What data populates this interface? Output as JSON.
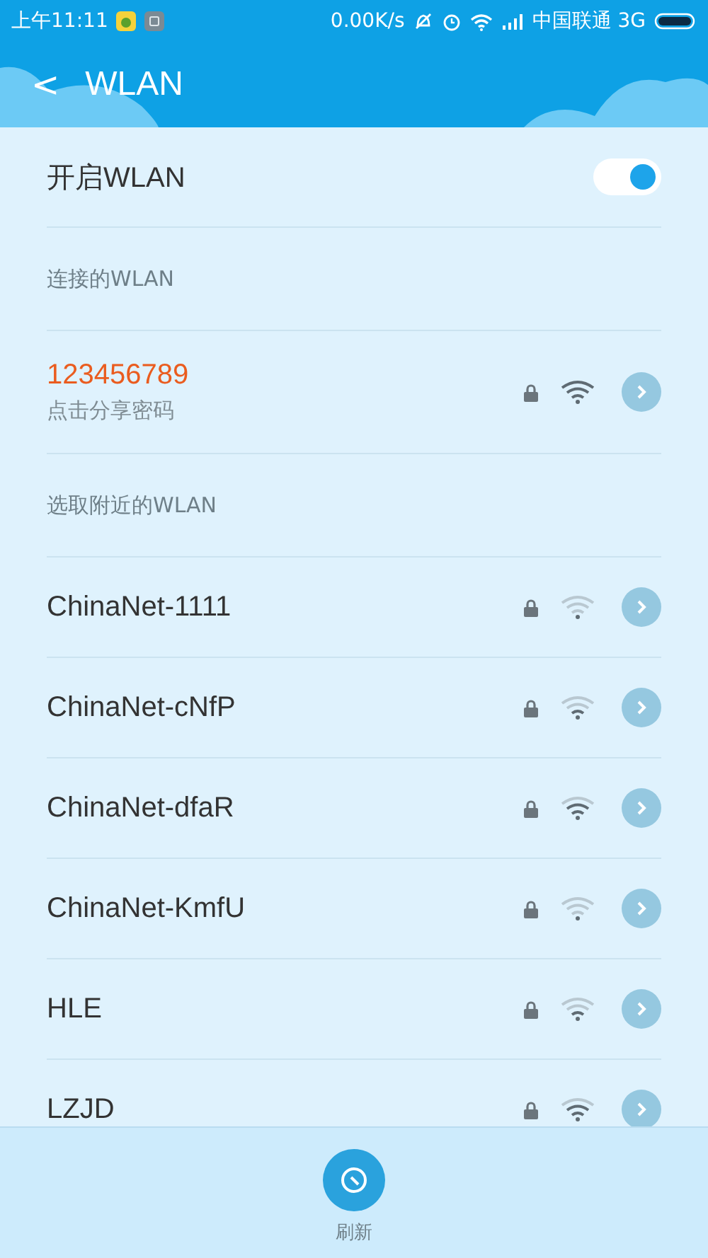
{
  "status_bar": {
    "time": "上午11:11",
    "speed": "0.00K/s",
    "carrier": "中国联通 3G"
  },
  "header": {
    "back": "<",
    "title": "WLAN"
  },
  "wlan_toggle": {
    "label": "开启WLAN",
    "on": true
  },
  "connected_section": {
    "title": "连接的WLAN"
  },
  "connected": {
    "name": "123456789",
    "subtitle": "点击分享密码",
    "locked": true,
    "kind": "full"
  },
  "nearby_section": {
    "title": "选取附近的WLAN"
  },
  "networks": [
    {
      "name": "ChinaNet-1111",
      "locked": true,
      "kind": "weak"
    },
    {
      "name": "ChinaNet-cNfP",
      "locked": true,
      "kind": "medium"
    },
    {
      "name": "ChinaNet-dfaR",
      "locked": true,
      "kind": "strong"
    },
    {
      "name": "ChinaNet-KmfU",
      "locked": true,
      "kind": "weak"
    },
    {
      "name": "HLE",
      "locked": true,
      "kind": "medium"
    },
    {
      "name": "LZJD",
      "locked": true,
      "kind": "strong"
    }
  ],
  "bottom_bar": {
    "refresh_label": "刷新"
  }
}
